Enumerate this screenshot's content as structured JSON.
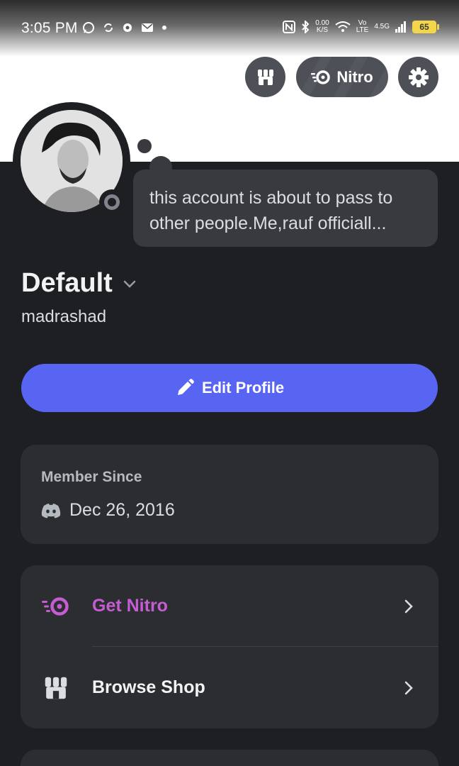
{
  "status_bar": {
    "time": "3:05 PM",
    "net_speed_value": "0.00",
    "net_speed_unit": "K/S",
    "volte_top": "Vo",
    "volte_bottom": "LTE",
    "network": "4.5G",
    "battery": "65"
  },
  "header": {
    "nitro_label": "Nitro"
  },
  "profile": {
    "custom_status_line1": "this account is about to pass to",
    "custom_status_line2": "other people.Me,rauf officiall...",
    "display_name": "Default",
    "username": "madrashad",
    "edit_profile_label": "Edit Profile"
  },
  "member_since": {
    "label": "Member Since",
    "date": "Dec 26, 2016"
  },
  "links": [
    {
      "label": "Get Nitro",
      "icon": "nitro-icon"
    },
    {
      "label": "Browse Shop",
      "icon": "shop-icon"
    }
  ],
  "colors": {
    "background": "#1e1f22",
    "card": "#2b2d31",
    "blurple": "#5865f2",
    "nitro_pink": "#c45dd1"
  }
}
